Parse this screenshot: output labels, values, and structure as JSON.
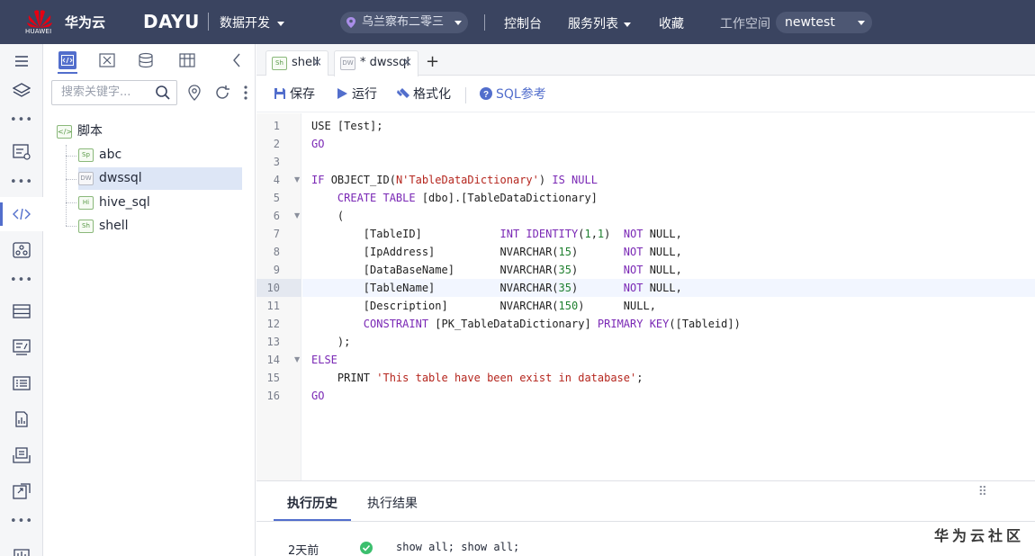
{
  "topbar": {
    "logo_text": "HUAWEI",
    "brand": "华为云",
    "product": "DAYU",
    "module": "数据开发",
    "region": "乌兰察布二零三",
    "nav": [
      "控制台",
      "服务列表",
      "收藏"
    ],
    "workspace_label": "工作空间",
    "workspace_value": "newtest"
  },
  "rail": {
    "icons": [
      "menu-icon",
      "layers-icon",
      "integration-icon",
      "code-icon",
      "workflow-icon",
      "list-icon",
      "form-icon",
      "catalog-icon",
      "report-icon",
      "stack-icon",
      "export-icon",
      "chart-icon"
    ],
    "active": "code-icon"
  },
  "tree": {
    "search_placeholder": "搜索关键字...",
    "root": {
      "label": "脚本",
      "badge": "</>"
    },
    "items": [
      {
        "label": "abc",
        "badge": "Sp",
        "selected": false
      },
      {
        "label": "dwssql",
        "badge": "DW",
        "selected": true
      },
      {
        "label": "hive_sql",
        "badge": "Hi",
        "selected": false
      },
      {
        "label": "shell",
        "badge": "Sh",
        "selected": false
      }
    ]
  },
  "editor": {
    "tabs": [
      {
        "label": "shell",
        "badge": "Sh",
        "close": "×"
      },
      {
        "label": "* dwssql",
        "badge": "DW",
        "close": "×",
        "active": true
      }
    ],
    "add_tab": "+",
    "toolbar": {
      "save": "保存",
      "run": "运行",
      "format": "格式化",
      "sql_help": "SQL参考"
    },
    "current_line": 10,
    "line_numbers": [
      "1",
      "2",
      "3",
      "4",
      "5",
      "6",
      "7",
      "8",
      "9",
      "10",
      "11",
      "12",
      "13",
      "14",
      "15",
      "16"
    ],
    "fold_lines": [
      4,
      6,
      14
    ],
    "code": [
      [
        {
          "t": "USE [Test];"
        }
      ],
      [
        {
          "t": "GO",
          "c": "k"
        }
      ],
      [
        {
          "t": ""
        }
      ],
      [
        {
          "t": "IF ",
          "c": "k"
        },
        {
          "t": "OBJECT_ID("
        },
        {
          "t": "N'TableDataDictionary'",
          "c": "s"
        },
        {
          "t": ") "
        },
        {
          "t": "IS NULL",
          "c": "k"
        }
      ],
      [
        {
          "t": "    "
        },
        {
          "t": "CREATE TABLE",
          "c": "k"
        },
        {
          "t": " [dbo].[TableDataDictionary]"
        }
      ],
      [
        {
          "t": "    ("
        }
      ],
      [
        {
          "t": "        [TableID]            "
        },
        {
          "t": "INT IDENTITY",
          "c": "k"
        },
        {
          "t": "("
        },
        {
          "t": "1",
          "c": "n"
        },
        {
          "t": ","
        },
        {
          "t": "1",
          "c": "n"
        },
        {
          "t": ")  "
        },
        {
          "t": "NOT",
          "c": "k"
        },
        {
          "t": " NULL,"
        }
      ],
      [
        {
          "t": "        [IpAddress]          NVARCHAR("
        },
        {
          "t": "15",
          "c": "n"
        },
        {
          "t": ")       "
        },
        {
          "t": "NOT",
          "c": "k"
        },
        {
          "t": " NULL,"
        }
      ],
      [
        {
          "t": "        [DataBaseName]       NVARCHAR("
        },
        {
          "t": "35",
          "c": "n"
        },
        {
          "t": ")       "
        },
        {
          "t": "NOT",
          "c": "k"
        },
        {
          "t": " NULL,"
        }
      ],
      [
        {
          "t": "        [TableName]          NVARCHAR("
        },
        {
          "t": "35",
          "c": "n"
        },
        {
          "t": ")       "
        },
        {
          "t": "NOT",
          "c": "k"
        },
        {
          "t": " NULL,"
        }
      ],
      [
        {
          "t": "        [Description]        NVARCHAR("
        },
        {
          "t": "150",
          "c": "n"
        },
        {
          "t": ")      NULL,"
        }
      ],
      [
        {
          "t": "        "
        },
        {
          "t": "CONSTRAINT",
          "c": "k"
        },
        {
          "t": " [PK_TableDataDictionary] "
        },
        {
          "t": "PRIMARY KEY",
          "c": "k"
        },
        {
          "t": "([Tableid])"
        }
      ],
      [
        {
          "t": "    );"
        }
      ],
      [
        {
          "t": "ELSE",
          "c": "k"
        }
      ],
      [
        {
          "t": "    PRINT "
        },
        {
          "t": "'This table have been exist in database'",
          "c": "s"
        },
        {
          "t": ";"
        }
      ],
      [
        {
          "t": "GO",
          "c": "k"
        }
      ]
    ]
  },
  "bottom": {
    "tabs": [
      "执行历史",
      "执行结果"
    ],
    "active_tab": "执行历史",
    "grip": "⠿",
    "history": [
      {
        "time": "2天前",
        "status": "success",
        "sql": "show all; show all;"
      }
    ]
  },
  "watermark": "华为云社区",
  "colors": {
    "topbar": "#3a4460",
    "accent": "#526ecc",
    "keyword": "#7a28b5",
    "string": "#b5261e",
    "number": "#208030",
    "success": "#3cbf6e"
  }
}
